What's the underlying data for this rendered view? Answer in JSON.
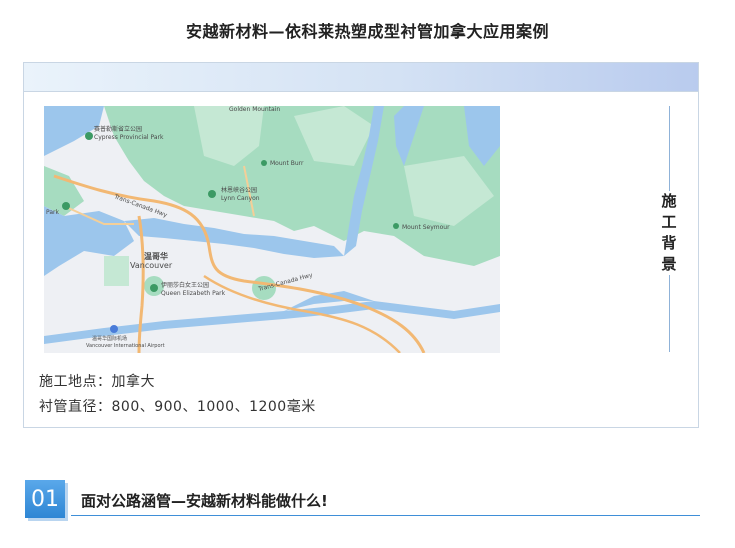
{
  "page_title": "安越新材料—依科莱热塑成型衬管加拿大应用案例",
  "background_card": {
    "side_label": "施工背景",
    "location_text": "施工地点：加拿大",
    "diameter_text": "衬管直径：800、900、1000、1200毫米"
  },
  "map": {
    "labels": {
      "vancouver_cn": "温哥华",
      "vancouver_en": "Vancouver",
      "qe_park_cn": "伊丽莎白女王公园",
      "qe_park_en": "Queen Elizabeth Park",
      "lynn_cn": "林恩峡谷公园",
      "lynn_en": "Lynn Canyon",
      "cypress_cn": "赛普勒斯省立公园",
      "cypress_en": "Cypress Provincial Park",
      "grouse": "Mount Burr",
      "golden": "Golden Mountain",
      "seymour": "Mount Seymour",
      "airport_cn": "温哥华国际机场",
      "airport_en": "Vancouver International Airport",
      "hwy1": "Trans-Canada Hwy",
      "hwy1b": "Trans-Canada Hwy",
      "park_left": "Park"
    }
  },
  "section": {
    "number": "01",
    "title": "面对公路涵管—安越新材料能做什么!"
  },
  "colors": {
    "accent": "#2e86d4",
    "water": "#9cc6ec",
    "forest": "#a6dcc0",
    "road": "#f2b873"
  }
}
